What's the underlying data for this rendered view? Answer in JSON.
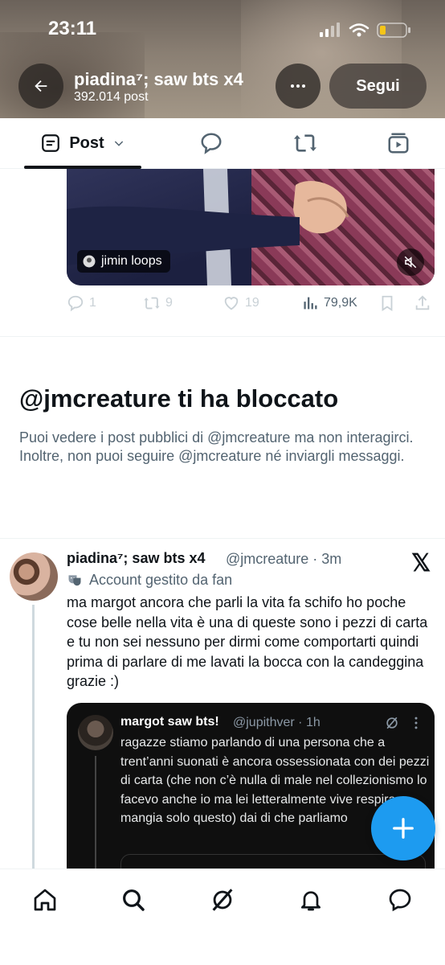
{
  "status_bar": {
    "time": "23:11"
  },
  "header": {
    "title": "piadina⁷; saw bts x4",
    "post_count": "392.014 post",
    "follow_label": "Segui",
    "back_icon": "arrow-left-icon",
    "more_icon": "more-horizontal-icon"
  },
  "tabs": [
    {
      "label": "Post",
      "icon": "post-list-icon"
    },
    {
      "label": "",
      "icon": "reply-bubble-icon"
    },
    {
      "label": "",
      "icon": "repost-icon"
    },
    {
      "label": "",
      "icon": "media-icon"
    }
  ],
  "media": {
    "tag": "jimin loops",
    "mute_icon": "volume-mute-icon"
  },
  "actions": {
    "replies": "1",
    "reposts": "9",
    "likes": "19",
    "views": "79,9K"
  },
  "blocked": {
    "title": "@jmcreature ti ha bloccato",
    "text": "Puoi vedere i post pubblici di @jmcreature ma non interagirci. Inoltre, non puoi seguire @jmcreature né inviargli messaggi."
  },
  "tweet": {
    "name": "piadina⁷; saw bts x4",
    "handle": "@jmcreature · 3m",
    "fan_label": "Account gestito da fan",
    "x_logo": "𝕏",
    "text": "ma margot ancora che parli la vita fa schifo ho poche cose belle nella vita è una di queste sono i pezzi di carta e tu non sei nessuno per dirmi come comportarti quindi prima di parlare di me lavati la bocca con la candeggina grazie :)"
  },
  "quote": {
    "name": "margot saw bts!",
    "handle": "@jupithver · 1h",
    "text": "ragazze stiamo parlando di una persona che a trent’anni suonati è ancora ossessionata con dei pezzi di carta (che non c’è nulla di male nel collezionismo lo facevo anche io ma lei letteralmente vive respira e mangia solo questo) dai di che parliamo"
  },
  "bottom_nav": [
    "home-icon",
    "search-icon",
    "grok-icon",
    "notifications-icon",
    "messages-icon"
  ],
  "colors": {
    "accent": "#1d9bf0",
    "text": "#0f1419",
    "secondary": "#536471"
  }
}
